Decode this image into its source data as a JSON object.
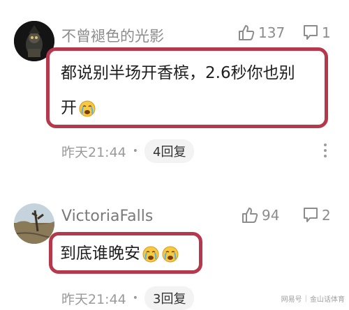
{
  "comments": [
    {
      "username": "不曾褪色的光影",
      "likes": "137",
      "replies_count": "1",
      "text_line1": "都说别半场开香槟，2.6秒你也别",
      "text_line2": "开",
      "emoji": "crying-face-emoji",
      "time": "昨天21:44",
      "reply_label": "4回复"
    },
    {
      "username": "VictoriaFalls",
      "likes": "94",
      "replies_count": "2",
      "text_line1": "到底谁晚安",
      "emoji": "crying-face-emoji",
      "time": "昨天21:44",
      "reply_label": "3回复"
    }
  ],
  "watermark": {
    "left": "网易号",
    "right": "金山话体育"
  },
  "colors": {
    "highlight": "#b5384d",
    "muted": "#8c8c8c"
  }
}
